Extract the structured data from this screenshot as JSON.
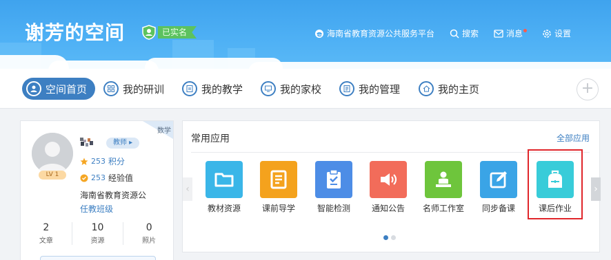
{
  "header": {
    "title": "谢芳的空间",
    "verified_label": "已实名",
    "nav": [
      {
        "label": "海南省教育资源公共服务平台",
        "icon": "platform-logo-icon"
      },
      {
        "label": "搜索",
        "icon": "search-icon"
      },
      {
        "label": "消息",
        "icon": "mail-icon",
        "has_dot": true
      },
      {
        "label": "设置",
        "icon": "gear-icon"
      }
    ]
  },
  "tabs": [
    {
      "label": "空间首页",
      "icon": "user-icon",
      "active": true
    },
    {
      "label": "我的研训",
      "icon": "grid-icon"
    },
    {
      "label": "我的教学",
      "icon": "board-icon"
    },
    {
      "label": "我的家校",
      "icon": "monitor-icon"
    },
    {
      "label": "我的管理",
      "icon": "list-icon"
    },
    {
      "label": "我的主页",
      "icon": "home-icon"
    }
  ],
  "profile": {
    "subject": "数学",
    "level": "LV 1",
    "role": "教师",
    "points": {
      "value": "253",
      "label": "积分"
    },
    "exp": {
      "value": "253",
      "label": "经验值"
    },
    "organization": "海南省教育资源公",
    "class_link": "任教班级",
    "counts": [
      {
        "value": "2",
        "label": "文章"
      },
      {
        "value": "10",
        "label": "资源"
      },
      {
        "value": "0",
        "label": "照片"
      }
    ]
  },
  "apps_panel": {
    "title": "常用应用",
    "all_label": "全部应用",
    "apps": [
      {
        "label": "教材资源",
        "icon": "folder-icon",
        "color": "#3ab6e8"
      },
      {
        "label": "课前导学",
        "icon": "document-icon",
        "color": "#f4a21d"
      },
      {
        "label": "智能检测",
        "icon": "clipboard-check-icon",
        "color": "#4d8de6"
      },
      {
        "label": "通知公告",
        "icon": "speaker-icon",
        "color": "#f26c5a"
      },
      {
        "label": "名师工作室",
        "icon": "teacher-icon",
        "color": "#6ec53c"
      },
      {
        "label": "同步备课",
        "icon": "edit-icon",
        "color": "#3aa4e6"
      },
      {
        "label": "课后作业",
        "icon": "backpack-icon",
        "color": "#38ccd9"
      }
    ],
    "pager": {
      "count": 2,
      "active": 1
    },
    "accent": "#3d7fc2",
    "highlight_color": "#e0252a"
  }
}
